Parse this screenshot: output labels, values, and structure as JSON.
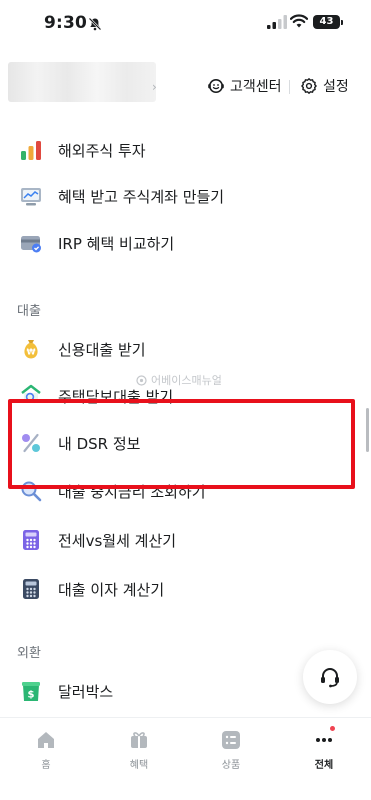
{
  "status_bar": {
    "time": "9:30",
    "battery": "43"
  },
  "header": {
    "support_label": "고객센터",
    "settings_label": "설정"
  },
  "sections": {
    "loan_label": "대출",
    "exchange_label": "외환"
  },
  "items": [
    {
      "label": "해외주식 투자",
      "icon": "bar-chart-icon"
    },
    {
      "label": "혜택 받고 주식계좌 만들기",
      "icon": "computer-chart-icon"
    },
    {
      "label": "IRP 혜택 비교하기",
      "icon": "card-icon"
    },
    {
      "label": "신용대출 받기",
      "icon": "money-bag-icon"
    },
    {
      "label": "주택담보대출 받기",
      "icon": "house-search-icon"
    },
    {
      "label": "내 DSR 정보",
      "icon": "percent-icon"
    },
    {
      "label": "대출 중지금리 조회하기",
      "icon": "magnifier-icon"
    },
    {
      "label": "전세vs월세 계산기",
      "icon": "calculator-purple-icon"
    },
    {
      "label": "대출 이자 계산기",
      "icon": "calculator-dark-icon"
    },
    {
      "label": "달러박스",
      "icon": "dollar-box-icon"
    }
  ],
  "watermark": "어베이스매뉴얼",
  "bottom_nav": [
    {
      "label": "홈",
      "icon": "home-icon"
    },
    {
      "label": "혜택",
      "icon": "gift-icon"
    },
    {
      "label": "상품",
      "icon": "list-icon"
    },
    {
      "label": "전체",
      "icon": "more-icon"
    }
  ],
  "colors": {
    "highlight": "#e8101b",
    "accent_dot": "#f04452"
  }
}
